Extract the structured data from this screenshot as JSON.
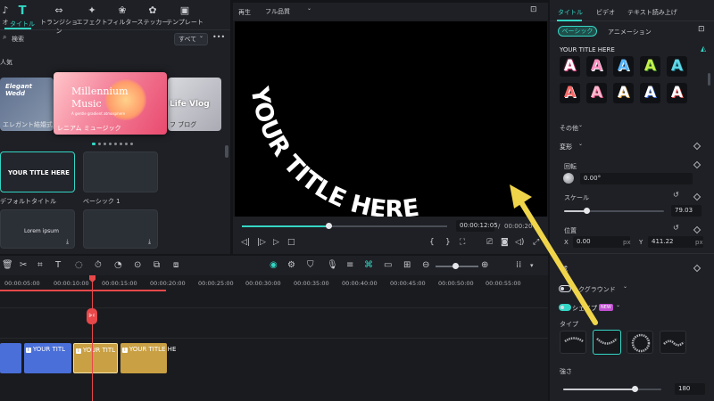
{
  "left_panel": {
    "tabs": [
      {
        "label": "オ",
        "icon": "audio-icon"
      },
      {
        "label": "タイトル",
        "icon": "title-T-icon",
        "active": true
      },
      {
        "label": "トランジション",
        "icon": "transition-icon"
      },
      {
        "label": "エフェクト",
        "icon": "effect-star-icon"
      },
      {
        "label": "フィルター",
        "icon": "filter-icon"
      },
      {
        "label": "ステッカー",
        "icon": "sticker-icon"
      },
      {
        "label": "テンプレート",
        "icon": "template-icon"
      }
    ],
    "search_placeholder": "検索",
    "filter_label": "すべて",
    "more_label": "•••",
    "section_popular": "人気",
    "carousel": {
      "left_title": "Elegant Wedd",
      "left_caption": "エレガント結婚式",
      "center_title_line1": "Millennium",
      "center_title_line2": "Music",
      "center_sub": "A gentle gradient atmosphere",
      "center_caption": "レニアム ミュージック",
      "right_title": "Life Vlog",
      "right_caption": "フ ブログ"
    },
    "cards": [
      {
        "text": "YOUR TITLE HERE",
        "label": "デフォルトタイトル"
      },
      {
        "text": "",
        "label": "ベーシック 1"
      },
      {
        "text": "Lorem ipsum",
        "label": ""
      },
      {
        "text": "",
        "label": ""
      }
    ]
  },
  "preview": {
    "label": "再生",
    "quality": "フル品質",
    "arc_text": "YOUR TITLE HERE",
    "time_current": "00:00:12:05",
    "time_separator": "/",
    "time_total": "00:00:20",
    "progress": 0.42
  },
  "right_panel": {
    "tabs": [
      "タイトル",
      "ビデオ",
      "テキスト読み上げ"
    ],
    "subtabs": [
      "ベーシック",
      "アニメーション"
    ],
    "preset_label": "YOUR TITLE HERE",
    "tile_letter": "A",
    "other_label": "その他",
    "transform_label": "変形",
    "rotate_label": "回転",
    "rotate_value": "0.00°",
    "scale_label": "スケール",
    "scale_value": "79.03",
    "scale_fraction": 0.22,
    "position_label": "位置",
    "x_label": "X",
    "x_value": "0.00",
    "x_unit": "px",
    "y_label": "Y",
    "y_value": "411.22",
    "y_unit": "px",
    "composite_label": "成",
    "background_label": "ックグラウンド",
    "shape_label": "シェイプ",
    "new_badge": "NEW",
    "type_label": "タイプ",
    "strength_label": "強さ",
    "strength_value": "180",
    "strength_fraction": 0.73
  },
  "timeline": {
    "ruler": [
      "00:00:05:00",
      "00:00:10:00",
      "00:00:15:00",
      "00:00:20:00",
      "00:00:25:00",
      "00:00:30:00",
      "00:00:35:00",
      "00:00:40:00",
      "00:00:45:00",
      "00:00:50:00",
      "00:00:55:00"
    ],
    "clips": [
      {
        "label": "",
        "color": "#4a6fd8"
      },
      {
        "label": "YOUR TITL",
        "color": "#4a6fd8"
      },
      {
        "label": "YOUR TITL",
        "color": "#c9a043"
      },
      {
        "label": "YOUR TITLE HE",
        "color": "#c9a043"
      }
    ]
  },
  "colors": {
    "accent": "#34d6c5",
    "playhead": "#e8484a",
    "annotation_arrow": "#f0d54a"
  }
}
